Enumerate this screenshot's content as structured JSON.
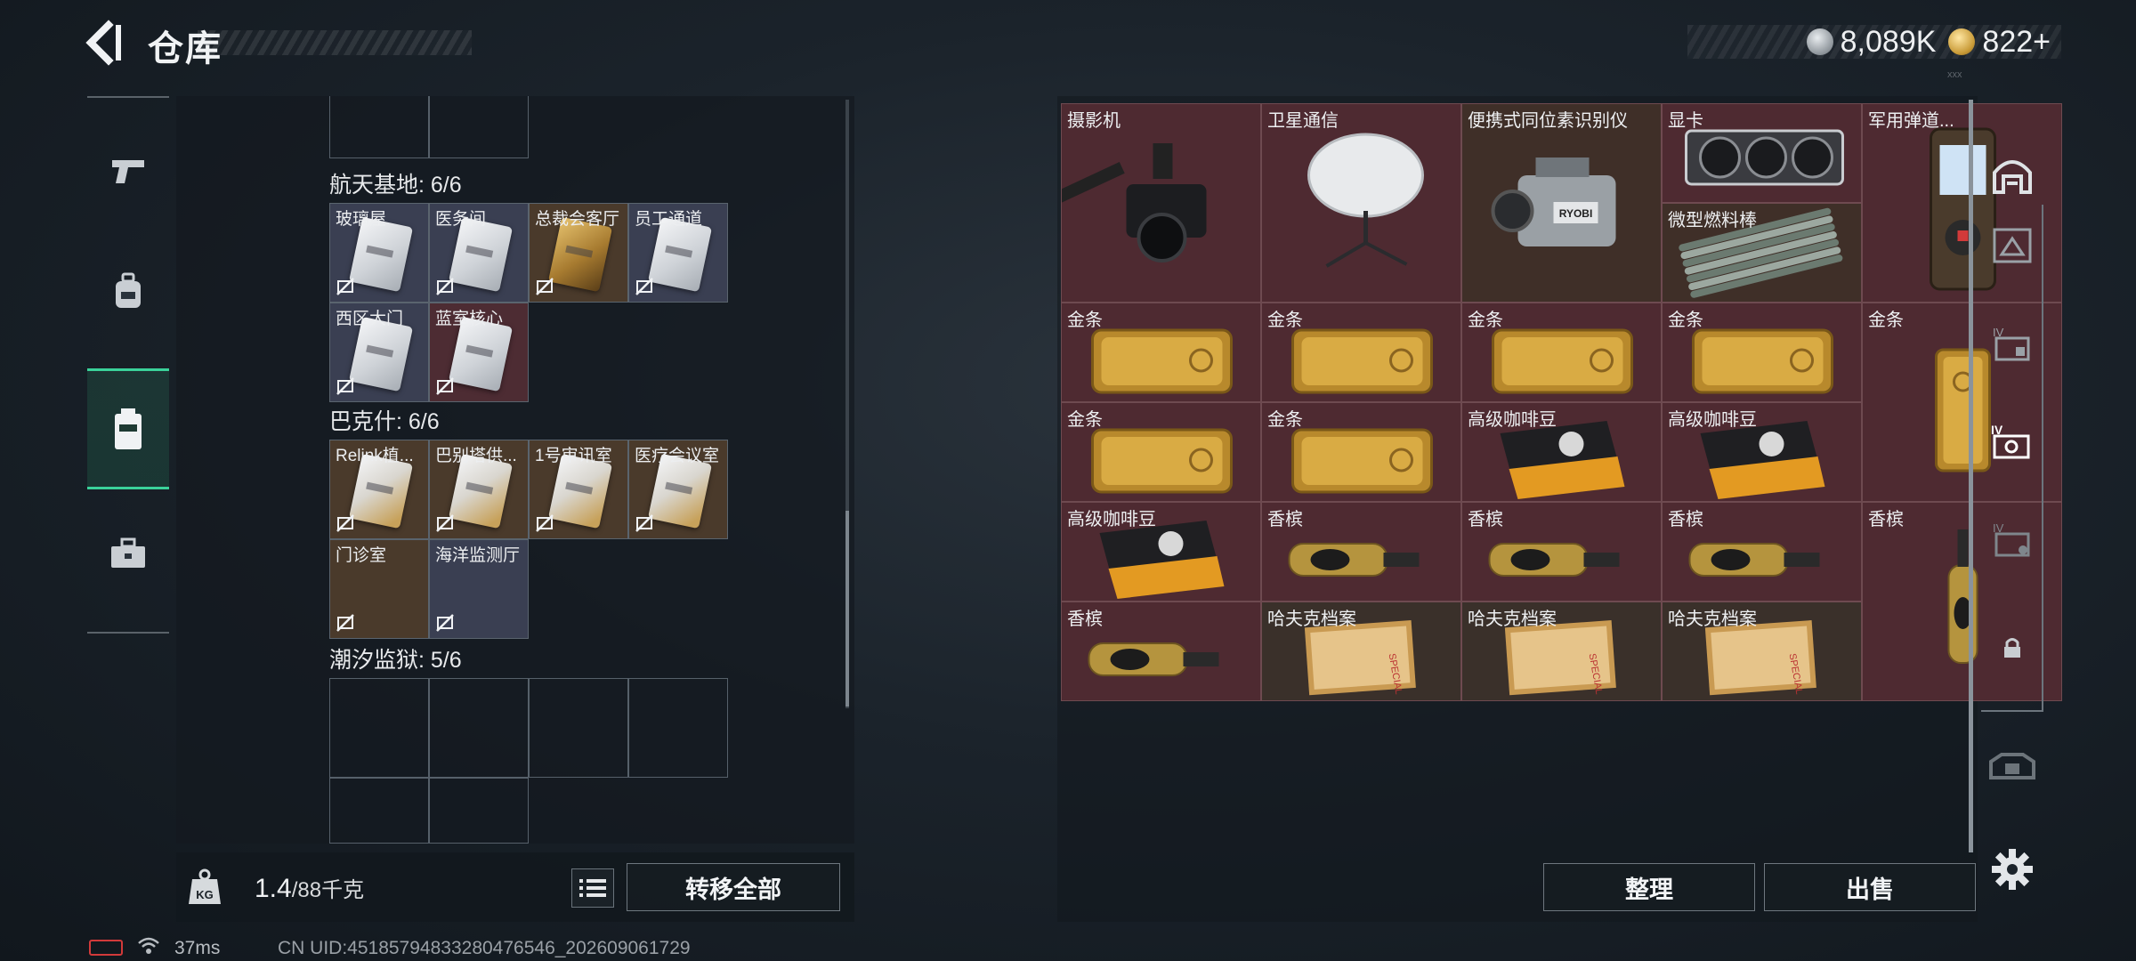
{
  "header": {
    "title": "仓库",
    "currency": [
      {
        "icon": "silver-coin-icon",
        "value": "8,089K"
      },
      {
        "icon": "gold-triangle-coin-icon",
        "value": "822+"
      }
    ],
    "version": "xxx"
  },
  "left_nav": [
    {
      "name": "weapon",
      "icon": "pistol-icon",
      "active": false
    },
    {
      "name": "backpack",
      "icon": "backpack-icon",
      "active": false
    },
    {
      "name": "cardholder",
      "icon": "card-case-icon",
      "active": true
    },
    {
      "name": "briefcase",
      "icon": "briefcase-icon",
      "active": false
    }
  ],
  "left_sections": [
    {
      "label": "航天基地: 6/6",
      "cards": [
        {
          "name": "玻璃屋",
          "color": "blue",
          "style": "white"
        },
        {
          "name": "医务间",
          "color": "blue",
          "style": "white"
        },
        {
          "name": "总裁会客厅",
          "color": "brown",
          "style": "gold"
        },
        {
          "name": "员工通道",
          "color": "blue",
          "style": "white"
        },
        {
          "name": "西区大门",
          "color": "blue",
          "style": "white"
        },
        {
          "name": "蓝室核心",
          "color": "red",
          "style": "white"
        }
      ]
    },
    {
      "label": "巴克什: 6/6",
      "cards": [
        {
          "name": "Relink植...",
          "color": "brown",
          "style": "white-gold"
        },
        {
          "name": "巴别塔供...",
          "color": "brown",
          "style": "white-gold"
        },
        {
          "name": "1号审讯室",
          "color": "brown",
          "style": "white-gold"
        },
        {
          "name": "医疗会议室",
          "color": "brown",
          "style": "white-gold"
        },
        {
          "name": "门诊室",
          "color": "brown",
          "style": "none"
        },
        {
          "name": "海洋监测厅",
          "color": "blue",
          "style": "none"
        }
      ]
    },
    {
      "label": "潮汐监狱: 5/6",
      "cards": []
    }
  ],
  "left_bottom": {
    "weight_current": "1.4",
    "weight_max": "/88千克",
    "transfer_all": "转移全部"
  },
  "stash_items": [
    {
      "name": "摄影机",
      "kind": "camera"
    },
    {
      "name": "卫星通信",
      "kind": "satellite"
    },
    {
      "name": "便携式同位素识别仪",
      "kind": "detector"
    },
    {
      "name": "显卡",
      "kind": "gpu"
    },
    {
      "name": "军用弹道...",
      "kind": "ballistic"
    },
    {
      "name": "微型燃料棒",
      "kind": "fuelrods"
    },
    {
      "name": "金条",
      "kind": "gold"
    },
    {
      "name": "金条",
      "kind": "gold"
    },
    {
      "name": "金条",
      "kind": "gold"
    },
    {
      "name": "金条",
      "kind": "gold"
    },
    {
      "name": "金条",
      "kind": "gold-v"
    },
    {
      "name": "金条",
      "kind": "gold"
    },
    {
      "name": "金条",
      "kind": "gold"
    },
    {
      "name": "高级咖啡豆",
      "kind": "coffee"
    },
    {
      "name": "高级咖啡豆",
      "kind": "coffee"
    },
    {
      "name": "高级咖啡豆",
      "kind": "coffee"
    },
    {
      "name": "香槟",
      "kind": "champagne"
    },
    {
      "name": "香槟",
      "kind": "champagne"
    },
    {
      "name": "香槟",
      "kind": "champagne"
    },
    {
      "name": "香槟",
      "kind": "champagne-v"
    },
    {
      "name": "香槟",
      "kind": "champagne"
    },
    {
      "name": "哈夫克档案",
      "kind": "file"
    },
    {
      "name": "哈夫克档案",
      "kind": "file"
    },
    {
      "name": "哈夫克档案",
      "kind": "file"
    }
  ],
  "right_buttons": {
    "sort": "整理",
    "sell": "出售"
  },
  "right_nav": [
    {
      "icon": "vault-icon"
    },
    {
      "icon": "warehouse-tab-1-icon"
    },
    {
      "icon": "warehouse-tab-2-icon"
    },
    {
      "icon": "warehouse-tab-3-icon"
    },
    {
      "icon": "warehouse-tab-4-icon"
    },
    {
      "icon": "lock-icon"
    },
    {
      "icon": "warehouse-locked-icon"
    }
  ],
  "status": {
    "ping": "37ms",
    "uid": "CN UID:4518579483328047654­6_202609061729"
  }
}
